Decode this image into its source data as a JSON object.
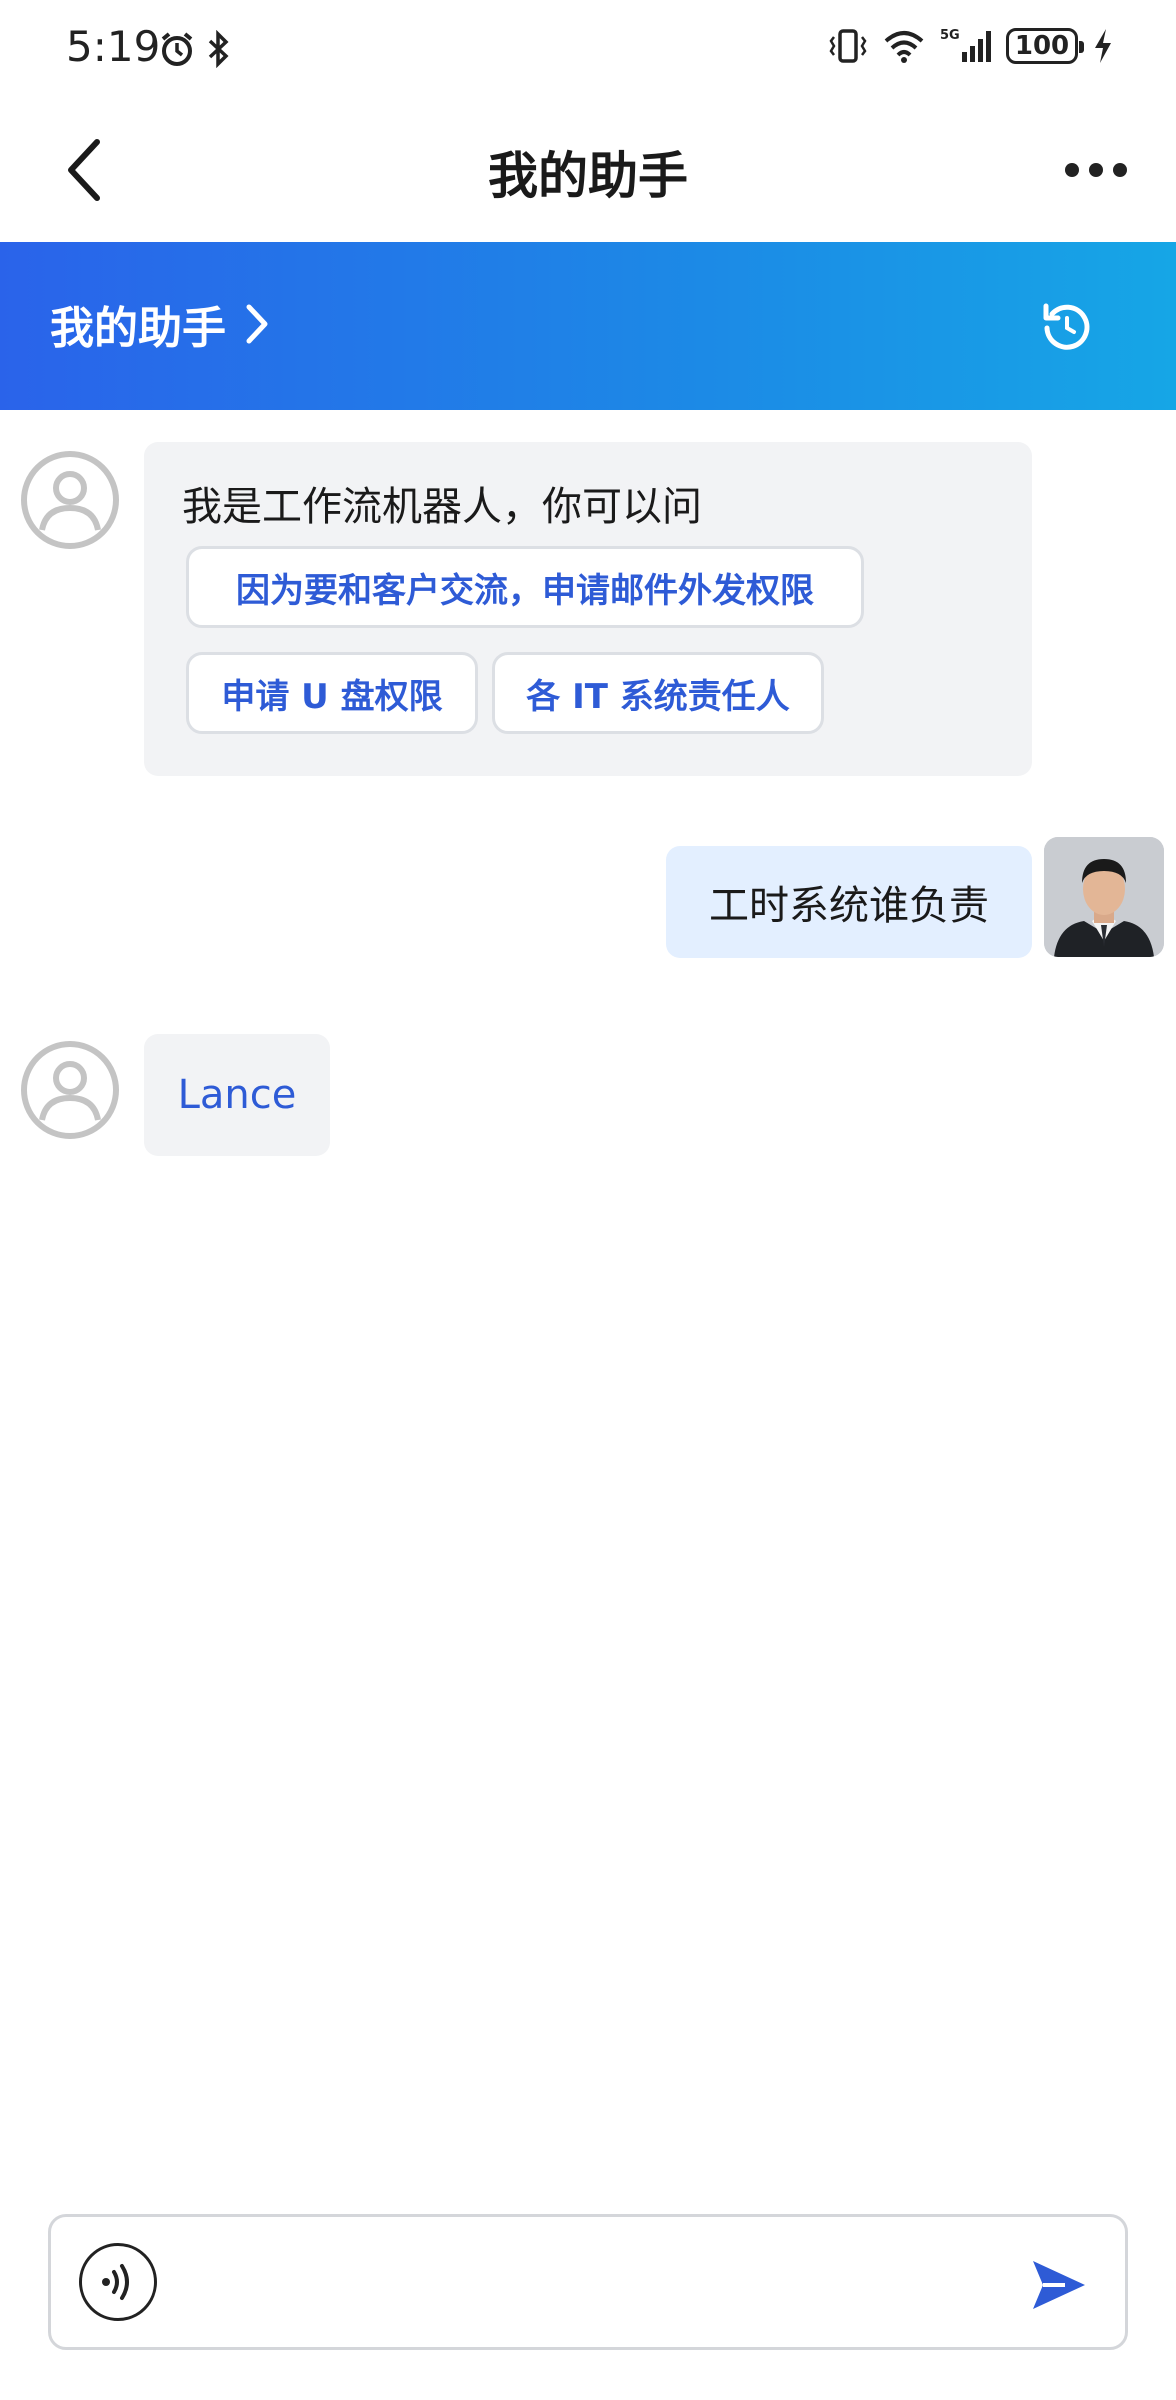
{
  "status_bar": {
    "time": "5:19",
    "battery": "100",
    "signal_label": "5G"
  },
  "nav": {
    "title": "我的助手"
  },
  "banner": {
    "title": "我的助手"
  },
  "chat": {
    "bot_greeting": "我是工作流机器人，你可以问",
    "suggestions": [
      "因为要和客户交流，申请邮件外发权限",
      "申请 U 盘权限",
      "各 IT 系统责任人"
    ],
    "user_message": "工时系统谁负责",
    "bot_reply": "Lance"
  },
  "input": {
    "placeholder": ""
  },
  "colors": {
    "accent": "#2e5bd6",
    "banner_start": "#2a63ea",
    "banner_end": "#16a6e6",
    "user_bubble": "#e3efff",
    "bot_bubble": "#f2f3f5"
  }
}
